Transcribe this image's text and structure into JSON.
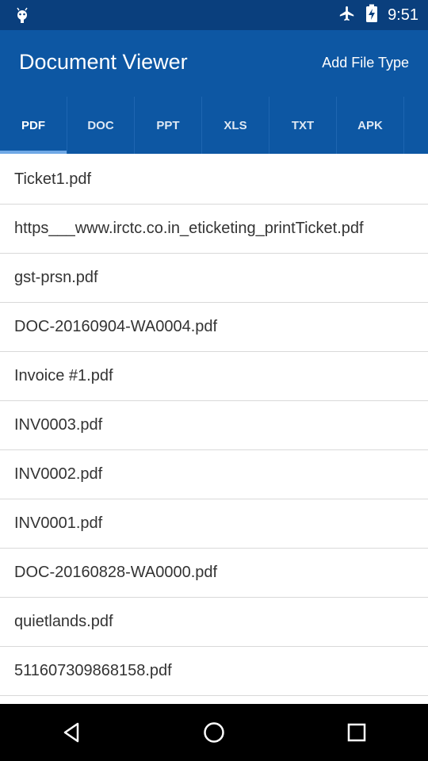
{
  "status_bar": {
    "time": "9:51",
    "icons": [
      "android-icon",
      "airplane-icon",
      "battery-charging-icon"
    ]
  },
  "app_bar": {
    "title": "Document Viewer",
    "action_label": "Add File Type"
  },
  "tabs": [
    {
      "label": "PDF",
      "active": true
    },
    {
      "label": "DOC",
      "active": false
    },
    {
      "label": "PPT",
      "active": false
    },
    {
      "label": "XLS",
      "active": false
    },
    {
      "label": "TXT",
      "active": false
    },
    {
      "label": "APK",
      "active": false
    }
  ],
  "files": [
    "Ticket1.pdf",
    "https___www.irctc.co.in_eticketing_printTicket.pdf",
    "gst-prsn.pdf",
    "DOC-20160904-WA0004.pdf",
    "Invoice #1.pdf",
    "INV0003.pdf",
    "INV0002.pdf",
    "INV0001.pdf",
    "DOC-20160828-WA0000.pdf",
    "quietlands.pdf",
    "511607309868158.pdf"
  ],
  "nav_bar": [
    "back-icon",
    "home-icon",
    "recents-icon"
  ],
  "colors": {
    "status_bar": "#0a3f7d",
    "app_bar": "#0d57a3",
    "tab_indicator": "#6fa8e6"
  }
}
